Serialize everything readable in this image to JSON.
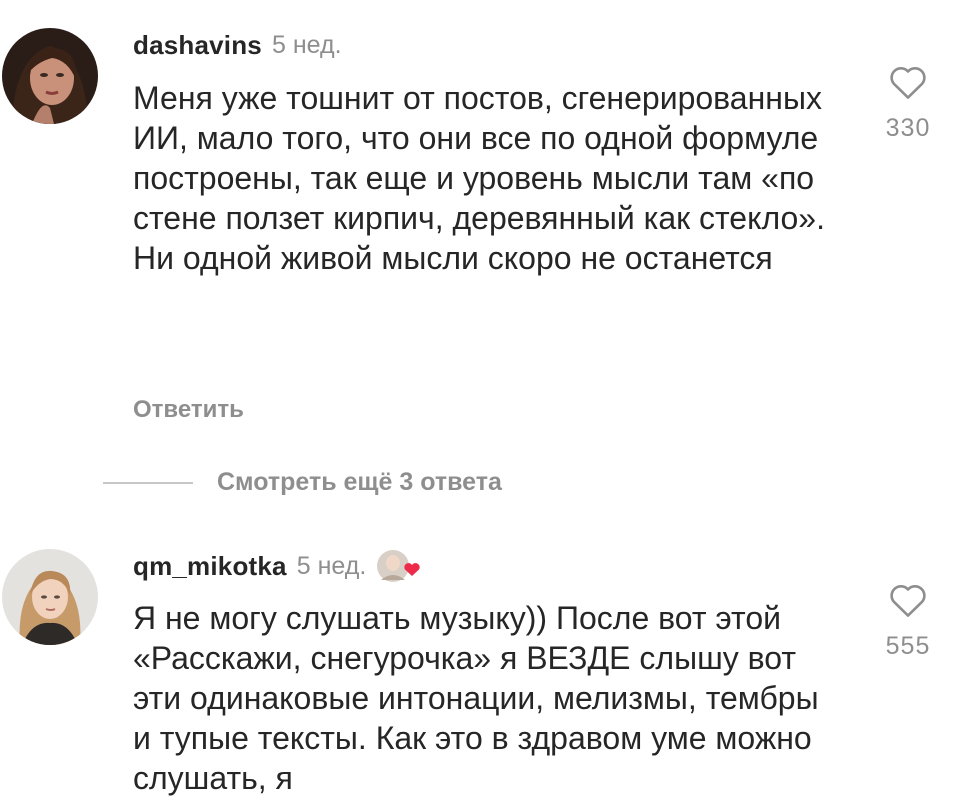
{
  "comments": [
    {
      "username": "dashavins",
      "time": "5 нед.",
      "text": "Меня уже тошнит от постов, сгенерированных ИИ, мало того, что они все по одной формуле построены, так еще и уровень мысли там «по стене ползет кирпич, деревянный как стекло». Ни одной живой мысли скоро не останется",
      "reply_label": "Ответить",
      "likes": "330"
    },
    {
      "username": "qm_mikotka",
      "time": "5 нед.",
      "text": "Я не могу слушать музыку)) После вот этой «Расскажи, снегурочка» я ВЕЗДЕ слышу вот эти одинаковые интонации, мелизмы, тембры и тупые тексты. Как это в здравом уме можно слушать, я",
      "likes": "555"
    }
  ],
  "view_replies_label": "Смотреть ещё 3 ответа",
  "icons": {
    "like": "heart-outline-icon",
    "author_like": "author-liked-heart-icon"
  },
  "colors": {
    "text": "#262626",
    "secondary": "#8e8e8e",
    "heart_red": "#ed2a4a"
  }
}
